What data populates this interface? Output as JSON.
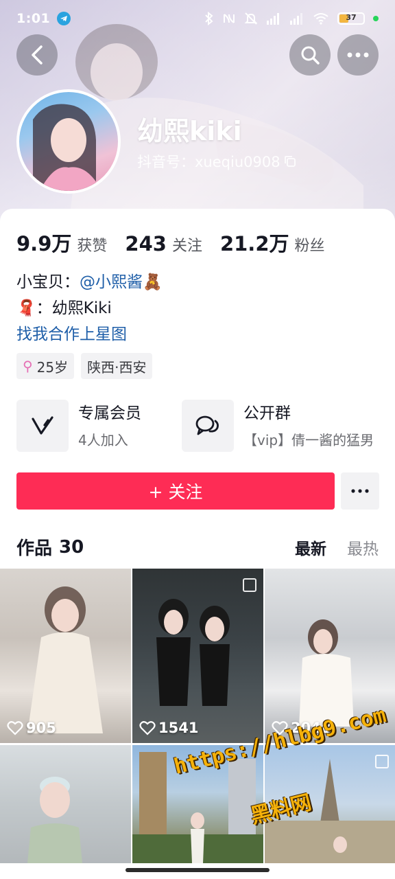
{
  "status_bar": {
    "time": "1:01",
    "battery": "37",
    "colors": {
      "battery_fill": "#f3b640",
      "dot": "#27d45a"
    }
  },
  "profile": {
    "nickname": "幼熙kiki",
    "douyin_id": "抖音号：xueqiu0908",
    "stats": [
      {
        "value": "9.9万",
        "label": "获赞"
      },
      {
        "value": "243",
        "label": "关注"
      },
      {
        "value": "21.2万",
        "label": "粉丝"
      }
    ],
    "bio": {
      "line1_prefix": "小宝贝：",
      "line1_mention": "@小熙酱",
      "line1_emoji": "🧸",
      "line2_emoji": "🧣",
      "line2_text": "：幼熙Kiki",
      "line3_link": "找我合作上星图"
    },
    "tags": [
      {
        "icon": "female-icon",
        "text": "25岁"
      },
      {
        "text": "陕西·西安"
      }
    ]
  },
  "features": [
    {
      "icon": "vip-v-icon",
      "title": "专属会员",
      "subtitle": "4人加入"
    },
    {
      "icon": "group-chat-icon",
      "title": "公开群",
      "subtitle": "【vip】倩一酱的猛男"
    }
  ],
  "actions": {
    "follow_label": "+ 关注",
    "follow_color": "#fe2c55"
  },
  "works": {
    "title": "作品",
    "count": "30",
    "sort_options": [
      "最新",
      "最热"
    ],
    "items": [
      {
        "likes": "905"
      },
      {
        "likes": "1541"
      },
      {
        "likes": "2048"
      },
      {
        "likes": ""
      },
      {
        "likes": ""
      },
      {
        "likes": ""
      }
    ]
  },
  "watermark": {
    "url": "https://hlbg9.com",
    "text": "黑料网"
  }
}
